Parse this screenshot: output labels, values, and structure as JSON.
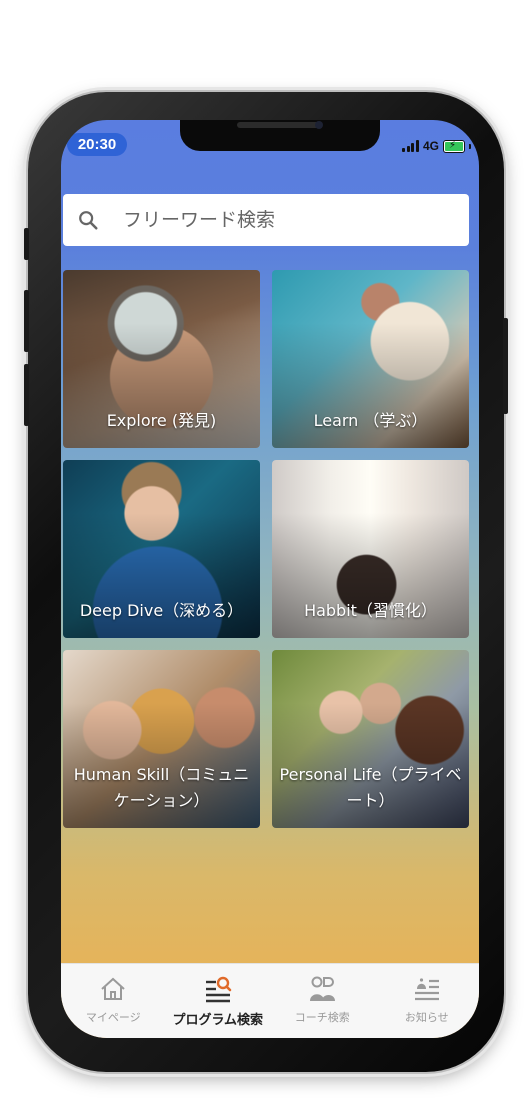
{
  "status_bar": {
    "time": "20:30",
    "network": "4G",
    "battery": "charging"
  },
  "search": {
    "placeholder": "フリーワード検索",
    "icon": "search-icon"
  },
  "categories": [
    {
      "label": "Explore (発見)"
    },
    {
      "label": "Learn （学ぶ）"
    },
    {
      "label": "Deep Dive（深める）"
    },
    {
      "label": "Habbit（習慣化）"
    },
    {
      "label": "Human Skill（コミュニケーション）"
    },
    {
      "label": "Personal Life（プライベート）"
    }
  ],
  "tabbar": {
    "tabs": [
      {
        "label": "マイページ",
        "icon": "home-icon",
        "active": false
      },
      {
        "label": "プログラム検索",
        "icon": "program-search-icon",
        "active": true
      },
      {
        "label": "コーチ検索",
        "icon": "coach-icon",
        "active": false
      },
      {
        "label": "お知らせ",
        "icon": "notification-icon",
        "active": false
      }
    ]
  },
  "colors": {
    "accent": "#2f63d6",
    "tab_active_icon": "#e06a2a",
    "tab_inactive": "#9a9a9a"
  }
}
